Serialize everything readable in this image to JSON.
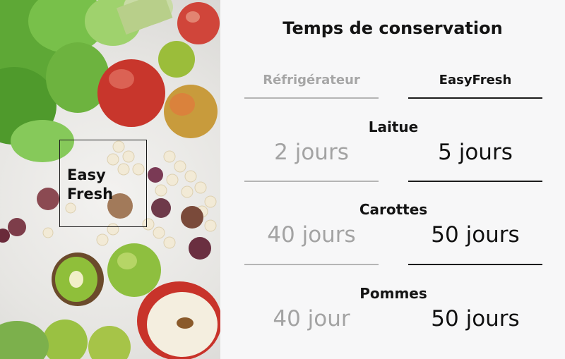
{
  "photo": {
    "label_line1": "Easy",
    "label_line2": "Fresh"
  },
  "panel": {
    "title": "Temps de conservation",
    "columns": {
      "left": "Réfrigérateur",
      "right": "EasyFresh"
    },
    "items": [
      {
        "name": "Laitue",
        "refrigerator": "2 jours",
        "easyfresh": "5 jours"
      },
      {
        "name": "Carottes",
        "refrigerator": "40 jours",
        "easyfresh": "50 jours"
      },
      {
        "name": "Pommes",
        "refrigerator": "40 jour",
        "easyfresh": "50 jours"
      }
    ]
  },
  "colors": {
    "panel_background": "#f7f7f8",
    "muted_text": "#a3a3a3",
    "dark_text": "#141414"
  }
}
